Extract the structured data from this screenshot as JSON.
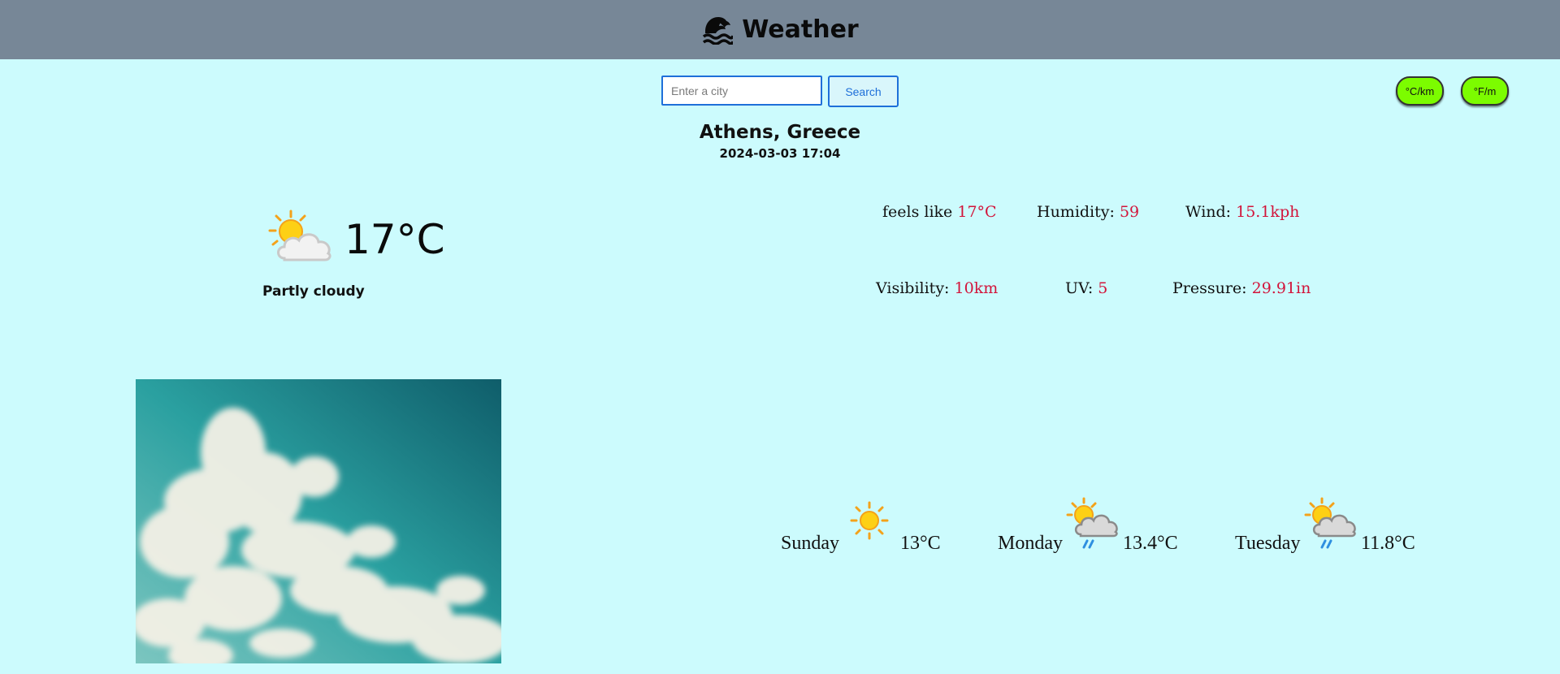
{
  "header": {
    "title": "Weather",
    "logo_icon": "water-wave-icon"
  },
  "search": {
    "placeholder": "Enter a city",
    "value": "",
    "button_label": "Search"
  },
  "units": {
    "metric_label": "°C/km",
    "imperial_label": "°F/m"
  },
  "location": {
    "city": "Athens, Greece",
    "datetime": "2024-03-03 17:04"
  },
  "current": {
    "temperature": "17°C",
    "condition": "Partly cloudy",
    "icon": "partly-cloudy-icon"
  },
  "details": {
    "feels_like": {
      "label": "feels like",
      "value": "17°C"
    },
    "humidity": {
      "label": "Humidity:",
      "value": "59"
    },
    "wind": {
      "label": "Wind:",
      "value": "15.1kph"
    },
    "visibility": {
      "label": "Visibility:",
      "value": "10km"
    },
    "uv": {
      "label": "UV:",
      "value": "5"
    },
    "pressure": {
      "label": "Pressure:",
      "value": "29.91in"
    }
  },
  "forecast": [
    {
      "day": "Sunday",
      "temp": "13°C",
      "icon": "sunny-icon"
    },
    {
      "day": "Monday",
      "temp": "13.4°C",
      "icon": "patchy-rain-icon"
    },
    {
      "day": "Tuesday",
      "temp": "11.8°C",
      "icon": "patchy-rain-icon"
    }
  ],
  "colors": {
    "header_bg": "#778797",
    "page_bg": "#ccfbfd",
    "accent_value": "#d2143a",
    "unit_button": "#7cfc00"
  }
}
